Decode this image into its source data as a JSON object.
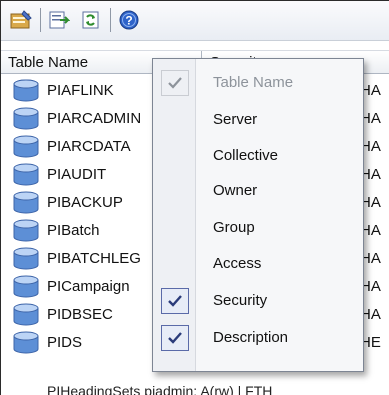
{
  "list": {
    "columns": [
      "Table Name",
      "Security"
    ],
    "rows": [
      {
        "name": "PIAFLINK",
        "tail": "HA"
      },
      {
        "name": "PIARCADMIN",
        "tail": "HA"
      },
      {
        "name": "PIARCDATA",
        "tail": "HA"
      },
      {
        "name": "PIAUDIT",
        "tail": "HA"
      },
      {
        "name": "PIBACKUP",
        "tail": "HA"
      },
      {
        "name": "PIBatch",
        "tail": "HA"
      },
      {
        "name": "PIBATCHLEG",
        "tail": "HA"
      },
      {
        "name": "PICampaign",
        "tail": "HA"
      },
      {
        "name": "PIDBSEC",
        "tail": "HA"
      },
      {
        "name": "PIDS",
        "tail": "HE"
      }
    ],
    "last_row": "PIHeadingSets     piadmin: A(rw) | FTH"
  },
  "context_menu": {
    "items": [
      {
        "label": "Table Name",
        "checked": true,
        "disabled": true
      },
      {
        "label": "Server",
        "checked": false,
        "disabled": false
      },
      {
        "label": "Collective",
        "checked": false,
        "disabled": false
      },
      {
        "label": "Owner",
        "checked": false,
        "disabled": false
      },
      {
        "label": "Group",
        "checked": false,
        "disabled": false
      },
      {
        "label": "Access",
        "checked": false,
        "disabled": false
      },
      {
        "label": "Security",
        "checked": true,
        "disabled": false
      },
      {
        "label": "Description",
        "checked": true,
        "disabled": false
      }
    ]
  },
  "toolbar": {
    "icons": [
      "properties-icon",
      "export-icon",
      "refresh-icon",
      "help-icon"
    ]
  },
  "colors": {
    "check_mark": "#2a3b7a",
    "disabled_check": "#8d939b",
    "db_icon_blue": "#5d8fd6"
  }
}
